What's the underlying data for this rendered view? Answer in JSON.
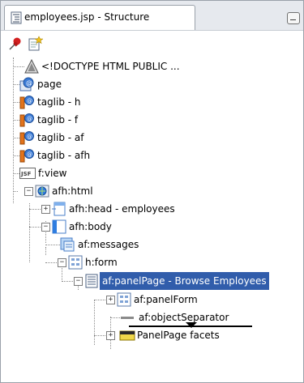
{
  "window": {
    "tab_title": "employees.jsp - Structure",
    "tab_icon": "structure-icon",
    "minimize_icon": "minimize-icon"
  },
  "toolbar": {
    "pin_icon": "pin-icon",
    "new_view_icon": "new-view-icon"
  },
  "tree": {
    "nodes": [
      {
        "label": "<!DOCTYPE HTML PUBLIC ...",
        "icon": "doctype-icon"
      },
      {
        "label": "page",
        "icon": "directive-icon"
      },
      {
        "label": "taglib - h",
        "icon": "taglib-icon"
      },
      {
        "label": "taglib - f",
        "icon": "taglib-icon"
      },
      {
        "label": "taglib - af",
        "icon": "taglib-icon"
      },
      {
        "label": "taglib - afh",
        "icon": "taglib-icon"
      },
      {
        "label": "f:view",
        "icon": "jsf-icon"
      },
      {
        "label": "afh:html",
        "icon": "globe-icon",
        "expanded": true
      },
      {
        "label": "afh:head - employees",
        "icon": "head-icon",
        "expanded": false
      },
      {
        "label": "afh:body",
        "icon": "body-icon",
        "expanded": true
      },
      {
        "label": "af:messages",
        "icon": "messages-icon"
      },
      {
        "label": "h:form",
        "icon": "form-icon",
        "expanded": true
      },
      {
        "label": "af:panelPage - Browse Employees",
        "icon": "panelpage-icon",
        "expanded": true,
        "selected": true
      },
      {
        "label": "af:panelForm",
        "icon": "panelform-icon",
        "expanded": false
      },
      {
        "label": "af:objectSeparator",
        "icon": "separator-icon"
      },
      {
        "label": "PanelPage facets",
        "icon": "facets-icon",
        "expanded": false
      }
    ]
  },
  "colors": {
    "selection": "#315dab",
    "titlebar": "#e6e9ee"
  }
}
